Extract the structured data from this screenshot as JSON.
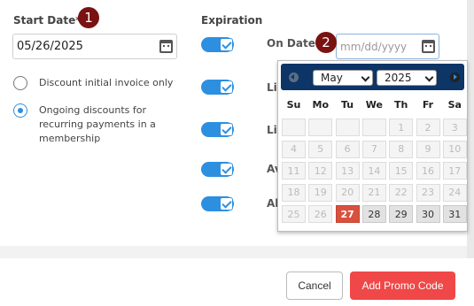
{
  "form": {
    "start_date_label": "Start Date*",
    "start_date_value": "05/26/2025",
    "badge_1": "1",
    "badge_2": "2",
    "radio_1_label": "Discount initial invoice only",
    "radio_2_label": "Ongoing discounts for recurring payments in a membership",
    "expiration_label": "Expiration",
    "on_date_label": "On Date",
    "on_date_placeholder": "mm/dd/yyyy",
    "row_labels": [
      "Lir",
      "Lir",
      "Av",
      "All"
    ]
  },
  "calendar": {
    "month": "May",
    "year": "2025",
    "weekdays": [
      "Su",
      "Mo",
      "Tu",
      "We",
      "Th",
      "Fr",
      "Sa"
    ],
    "rows": [
      [
        "",
        "",
        "",
        "",
        "1",
        "2",
        "3"
      ],
      [
        "4",
        "5",
        "6",
        "7",
        "8",
        "9",
        "10"
      ],
      [
        "11",
        "12",
        "13",
        "14",
        "15",
        "16",
        "17"
      ],
      [
        "18",
        "19",
        "20",
        "21",
        "22",
        "23",
        "24"
      ],
      [
        "25",
        "26",
        "27",
        "28",
        "29",
        "30",
        "31"
      ]
    ],
    "today": "27",
    "accent_color": "#d9503f",
    "header_color": "#0d3566"
  },
  "footer": {
    "cancel_label": "Cancel",
    "add_label": "Add Promo Code",
    "add_color": "#f04848"
  }
}
